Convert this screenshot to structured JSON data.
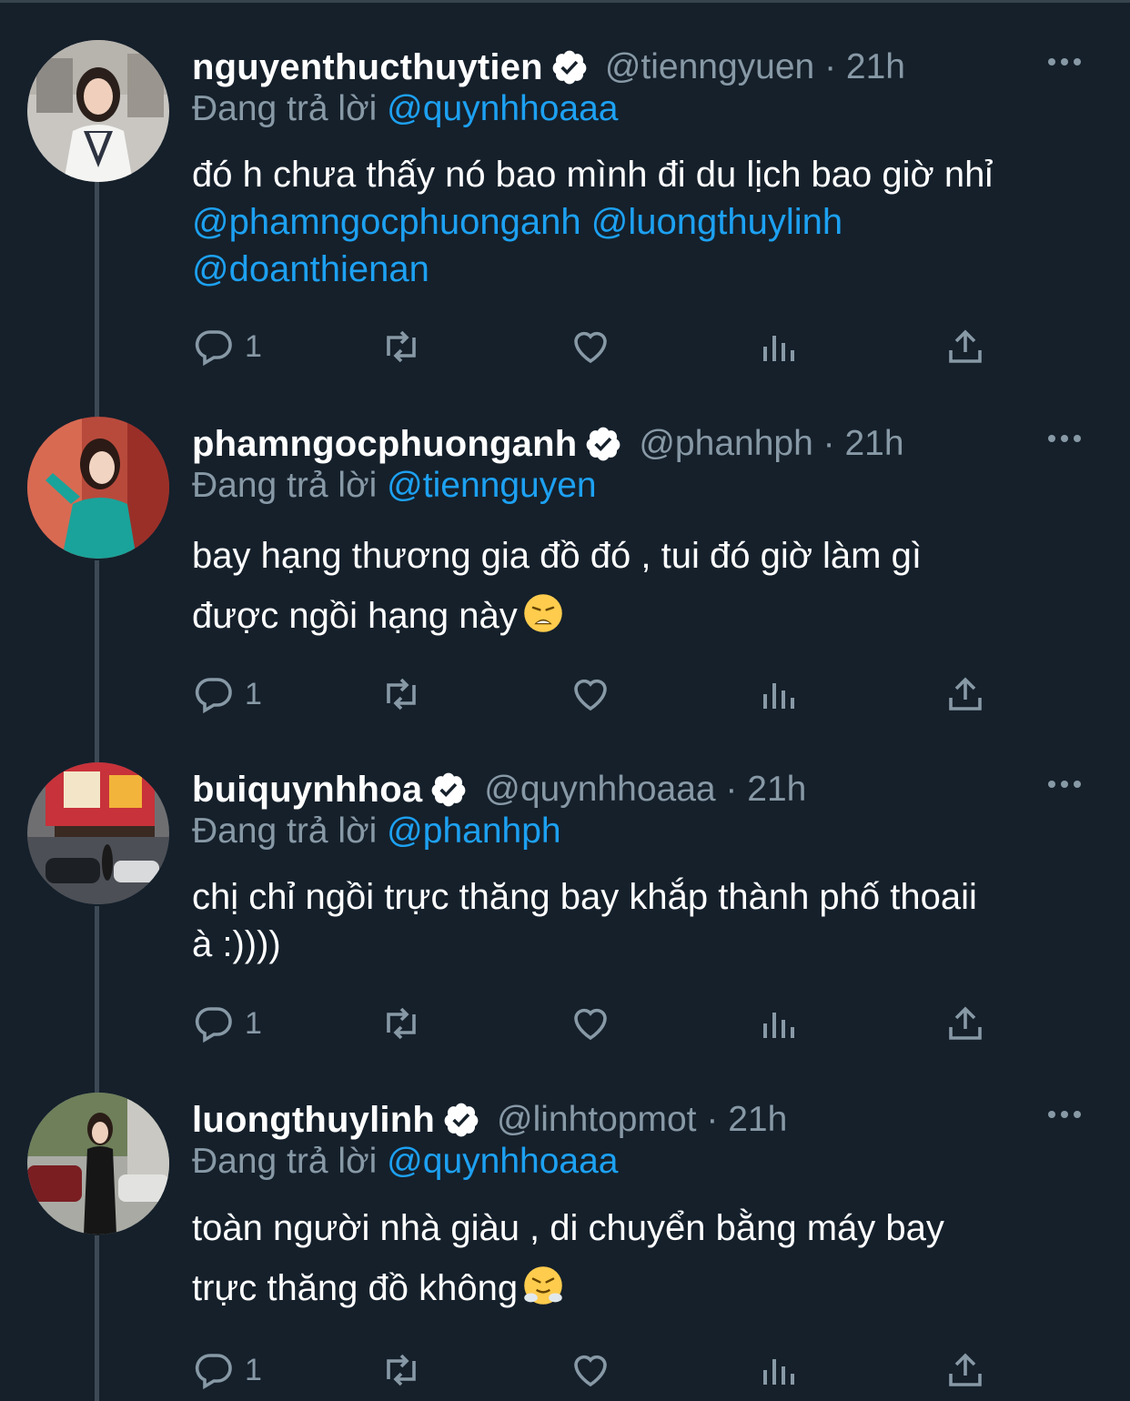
{
  "tweets": [
    {
      "name": "nguyenthucthuytien",
      "handle": "@tienngyuen",
      "time": "21h",
      "reply_prefix": "Đang trả lời",
      "reply_to": "@quynhhoaaa",
      "lines": [
        "đó h chưa thấy nó bao mình đi du lịch bao giờ nhỉ"
      ],
      "mentions": [
        "@phamngocphuonganh",
        "@luongthuylinh",
        "@doanthienan"
      ],
      "reply_count": "1"
    },
    {
      "name": "phamngocphuonganh",
      "handle": "@phanhph",
      "time": "21h",
      "reply_prefix": "Đang trả lời",
      "reply_to": "@tiennguyen",
      "lines": [
        "bay hạng thương gia đồ đó , tui đó giờ làm gì",
        "được ngồi hạng này"
      ],
      "emoji": "weary-face",
      "reply_count": "1"
    },
    {
      "name": "buiquynhhoa",
      "handle": "@quynhhoaaa",
      "time": "21h",
      "reply_prefix": "Đang trả lời",
      "reply_to": "@phanhph",
      "lines": [
        "chị chỉ ngồi trực thăng bay khắp thành phố thoaii",
        "à :))))"
      ],
      "reply_count": "1"
    },
    {
      "name": "luongthuylinh",
      "handle": "@linhtopmot",
      "time": "21h",
      "reply_prefix": "Đang trả lời",
      "reply_to": "@quynhhoaaa",
      "lines": [
        "toàn người nhà giàu , di chuyển bằng máy bay",
        "trực thăng đồ không"
      ],
      "emoji": "steam-nose-face",
      "reply_count": "1"
    }
  ],
  "colors": {
    "background": "#15202b",
    "mention": "#1da1f2",
    "muted": "#8899a6",
    "thread_line": "#3d4a55"
  }
}
